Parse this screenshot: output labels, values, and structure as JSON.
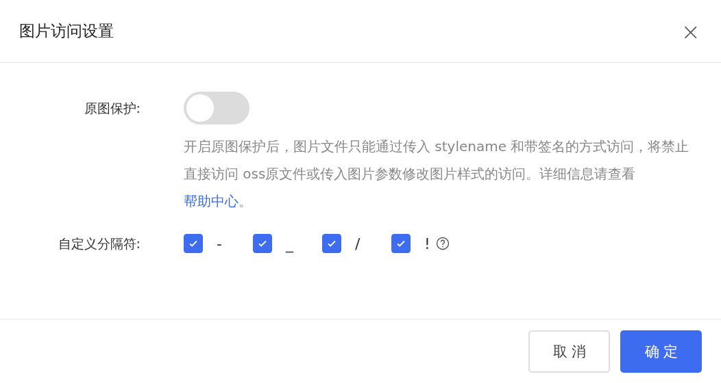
{
  "dialog": {
    "title": "图片访问设置",
    "close_icon": "×"
  },
  "protection": {
    "label": "原图保护:",
    "on": false,
    "description": "开启原图保护后，图片文件只能通过传入 stylename 和带签名的方式访问，将禁止直接访问 oss原文件或传入图片参数修改图片样式的访问。详细信息请查看",
    "link": "帮助中心",
    "after": "。"
  },
  "separators": {
    "label": "自定义分隔符:",
    "items": [
      {
        "char": "-",
        "checked": true
      },
      {
        "char": "_",
        "checked": true
      },
      {
        "char": "/",
        "checked": true
      },
      {
        "char": "!",
        "checked": true
      }
    ]
  },
  "buttons": [
    {
      "label": "取消",
      "kind": "secondary"
    },
    {
      "label": "确定",
      "kind": "primary"
    }
  ]
}
